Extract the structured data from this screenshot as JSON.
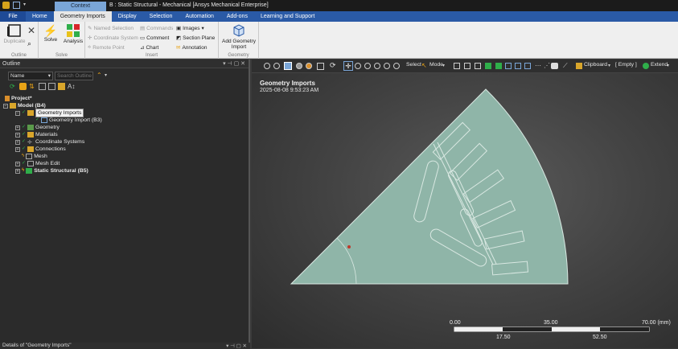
{
  "titlebar": {
    "context_tab": "Context",
    "title": "B : Static Structural - Mechanical [Ansys Mechanical Enterprise]"
  },
  "tabs": [
    "File",
    "Home",
    "Geometry Imports",
    "Display",
    "Selection",
    "Automation",
    "Add-ons",
    "Learning and Support"
  ],
  "ribbon": {
    "outline_group": {
      "label": "Outline",
      "duplicate": "Duplicate"
    },
    "solve_group": {
      "label": "Solve",
      "solve": "Solve",
      "analysis": "Analysis"
    },
    "insert_group": {
      "label": "Insert",
      "named_selection": "Named Selection",
      "coordinate_system": "Coordinate System",
      "remote_point": "Remote Point",
      "commands": "Commands",
      "comment": "Comment",
      "chart": "Chart",
      "images": "Images",
      "section_plane": "Section Plane",
      "annotation": "Annotation"
    },
    "geometry_group": {
      "label": "Geometry",
      "add_geometry_import_1": "Add Geometry",
      "add_geometry_import_2": "Import"
    }
  },
  "outline": {
    "title": "Outline",
    "name_filter": "Name",
    "search_placeholder": "Search Outline",
    "tree": [
      {
        "label": "Project*",
        "level": 0,
        "bold": true
      },
      {
        "label": "Model (B4)",
        "level": 1,
        "bold": true
      },
      {
        "label": "Geometry Imports",
        "level": 2,
        "selected": true
      },
      {
        "label": "Geometry Import (B3)",
        "level": 3
      },
      {
        "label": "Geometry",
        "level": 2
      },
      {
        "label": "Materials",
        "level": 2
      },
      {
        "label": "Coordinate Systems",
        "level": 2
      },
      {
        "label": "Connections",
        "level": 2
      },
      {
        "label": "Mesh",
        "level": 2
      },
      {
        "label": "Mesh Edit",
        "level": 2
      },
      {
        "label": "Static Structural (B5)",
        "level": 2,
        "bold": true
      }
    ]
  },
  "details": {
    "title": "Details of \"Geometry Imports\""
  },
  "viewport": {
    "toolbar": {
      "select": "Select",
      "mode": "Mode",
      "clipboard": "Clipboard",
      "empty": "[ Empty ]",
      "extend": "Extend"
    },
    "title": "Geometry Imports",
    "timestamp": "2025-08-08 9:53:23 AM"
  },
  "scale": {
    "top_labels": [
      "0.00",
      "35.00",
      "70.00 (mm)"
    ],
    "bottom_labels": [
      "17.50",
      "52.50"
    ]
  },
  "colors": {
    "tab_blue": "#2a5aa6",
    "geometry_fill": "#8fb5a8",
    "geometry_edge": "#d9e8e2",
    "viewport_bg": "#444444"
  }
}
